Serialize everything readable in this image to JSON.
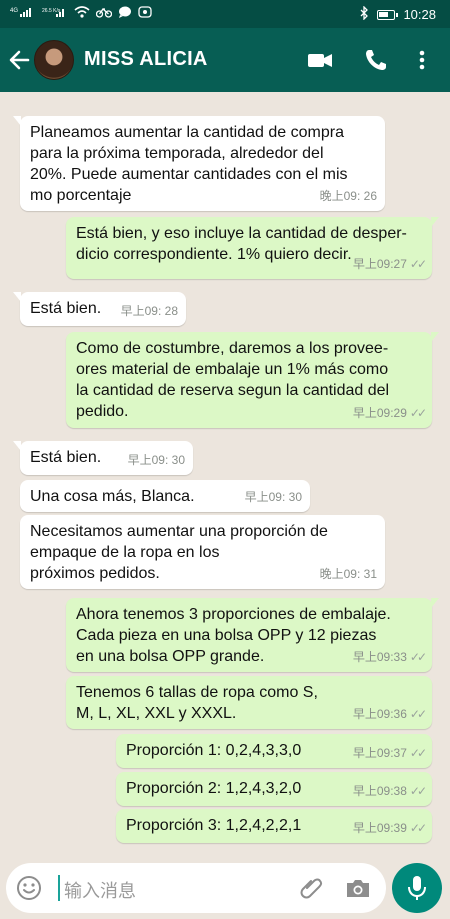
{
  "status": {
    "left_icons": [
      "4G",
      "26.5 K/s",
      "wifi",
      "bike",
      "chat",
      "game"
    ],
    "time": "10:28",
    "battery_level": 0.65
  },
  "header": {
    "contact_name": "MISS ALICIA"
  },
  "messages": [
    {
      "dir": "in",
      "text": "Planeamos aumentar la cantidad de compra\npara la próxima temporada, alrededor del\n20%. Puede aumentar cantidades con el mis\nmo porcentaje",
      "time": "晚上09: 26"
    },
    {
      "dir": "out",
      "text": "Está bien, y eso incluye la cantidad de desper-\ndicio correspondiente. 1% quiero decir.",
      "time": "早上09:27",
      "ticks": "✓✓"
    },
    {
      "dir": "in",
      "text": "Está bien.",
      "time": "早上09: 28"
    },
    {
      "dir": "out",
      "text": "Como de costumbre, daremos a los provee-\nores material de embalaje un 1% más como\nla cantidad de reserva segun la cantidad del\npedido.",
      "time": "早上09:29",
      "ticks": "✓✓"
    },
    {
      "dir": "in",
      "text": "Está bien.",
      "time": "早上09: 30"
    },
    {
      "dir": "in",
      "text": "Una cosa más, Blanca.",
      "time": "早上09: 30"
    },
    {
      "dir": "in",
      "text": "Necesitamos aumentar una proporción de\nempaque de la ropa en los\npróximos pedidos.",
      "time": "晚上09: 31"
    },
    {
      "dir": "out",
      "text": "Ahora tenemos 3 proporciones de embalaje.\nCada pieza en una bolsa OPP y 12 piezas\nen una bolsa OPP grande.",
      "time": "早上09:33",
      "ticks": "✓✓"
    },
    {
      "dir": "out",
      "text": "Tenemos 6 tallas de ropa como S,\nM, L, XL, XXL y XXXL.",
      "time": "早上09:36",
      "ticks": "✓✓"
    },
    {
      "dir": "out",
      "text": "Proporción 1: 0,2,4,3,3,0",
      "time": "早上09:37",
      "ticks": "✓✓"
    },
    {
      "dir": "out",
      "text": "Proporción 2: 1,2,4,3,2,0",
      "time": "早上09:38",
      "ticks": "✓✓"
    },
    {
      "dir": "out",
      "text": "Proporción 3: 1,2,4,2,2,1",
      "time": "早上09:39",
      "ticks": "✓✓"
    }
  ],
  "composer": {
    "placeholder": "输入消息"
  },
  "colors": {
    "header": "#075e54",
    "status_bar": "#054d44",
    "chat_bg": "#ece5dd",
    "outgoing": "#dcf8c6",
    "incoming": "#ffffff",
    "mic": "#00897b"
  }
}
